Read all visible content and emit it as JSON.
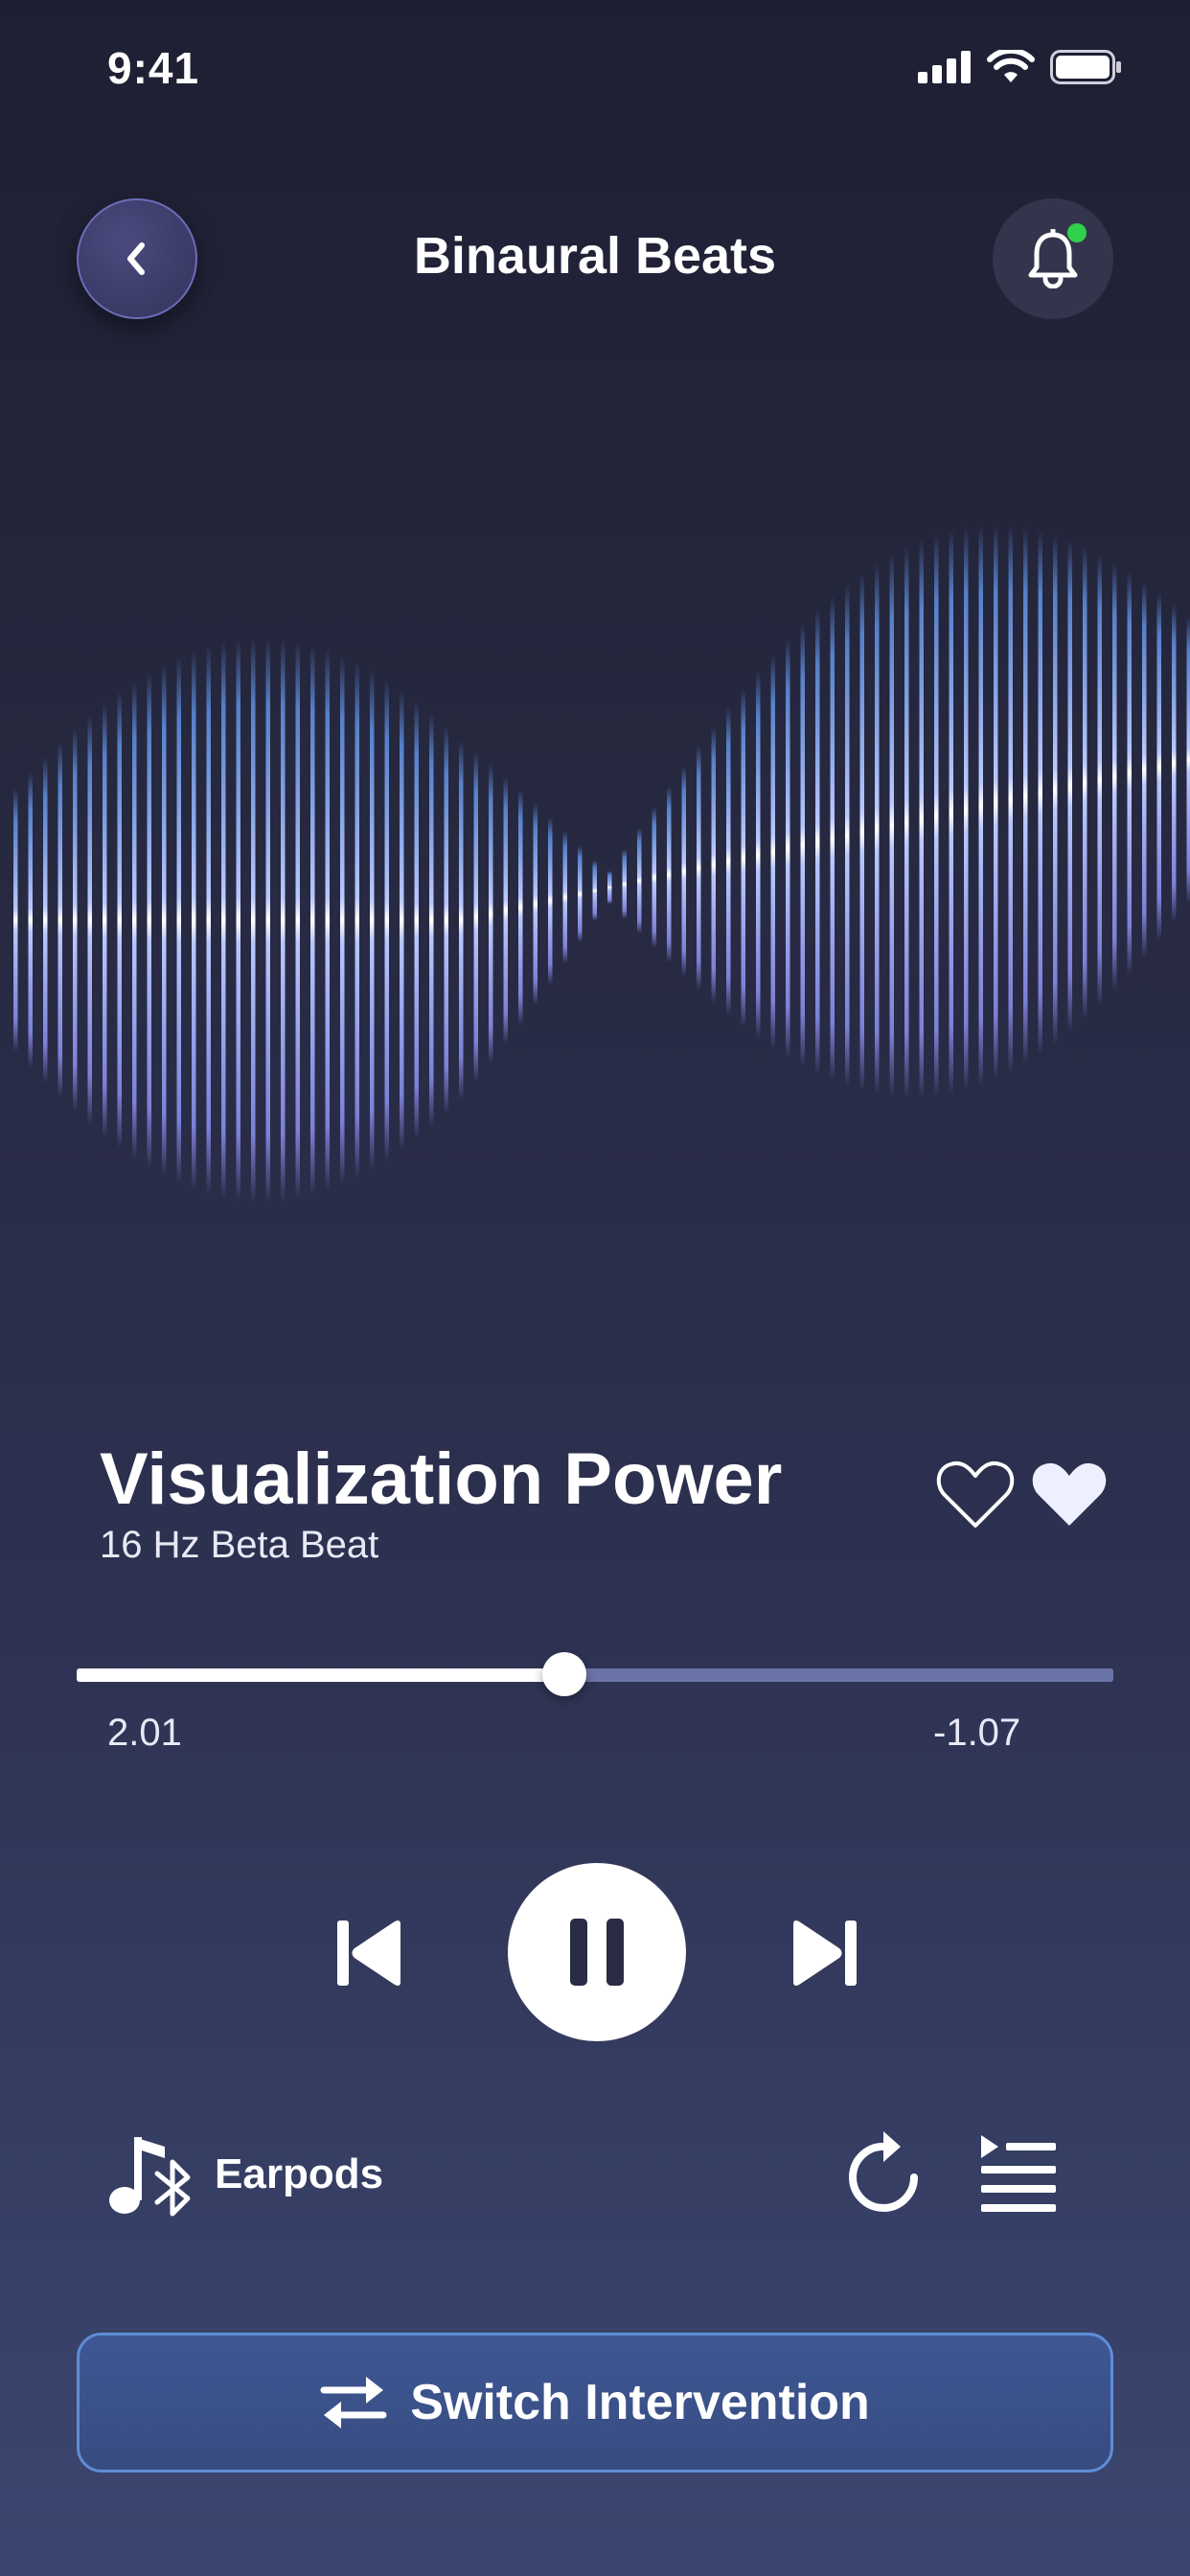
{
  "status_bar": {
    "time": "9:41",
    "icons": [
      "cellular-signal-icon",
      "wifi-icon",
      "battery-icon"
    ]
  },
  "header": {
    "title": "Binaural Beats",
    "back_icon": "chevron-left-icon",
    "bell_icon": "bell-icon",
    "notification_dot_color": "#2fd14a"
  },
  "track": {
    "title": "Visualization Power",
    "subtitle": "16 Hz Beta Beat"
  },
  "favorites": {
    "outline_icon": "heart-outline-icon",
    "filled_icon": "heart-filled-icon"
  },
  "playback": {
    "elapsed": "2.01",
    "remaining": "-1.07",
    "progress": 0.47
  },
  "controls": {
    "previous_icon": "skip-previous-icon",
    "pause_icon": "pause-icon",
    "next_icon": "skip-next-icon"
  },
  "output": {
    "device_label": "Earpods",
    "device_icon": "music-bluetooth-icon",
    "repeat_icon": "replay-icon",
    "queue_icon": "playlist-icon"
  },
  "action": {
    "switch_label": "Switch Intervention",
    "switch_icon": "swap-arrows-icon"
  },
  "colors": {
    "accent": "#5f8dd6",
    "wave_blue": "#5e8fe0",
    "wave_violet": "#8b8ff0",
    "progress_track": "#6b74a6"
  }
}
